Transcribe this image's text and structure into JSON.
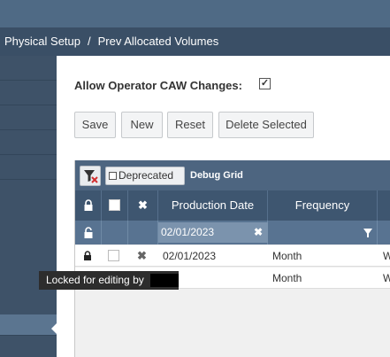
{
  "breadcrumb": {
    "items": [
      "Physical Setup",
      "Prev Allocated Volumes"
    ],
    "separator": "/"
  },
  "form": {
    "allow_operator_caw_label": "Allow Operator CAW Changes:",
    "allow_operator_caw_checked": true
  },
  "toolbar": {
    "save_label": "Save",
    "new_label": "New",
    "reset_label": "Reset",
    "delete_selected_label": "Delete Selected"
  },
  "grid": {
    "deprecated_label": "Deprecated",
    "debug_label": "Debug Grid",
    "columns": [
      "Production Date",
      "Frequency"
    ],
    "filter": {
      "production_date": "02/01/2023"
    },
    "rows": [
      {
        "locked": true,
        "checked": false,
        "production_date": "02/01/2023",
        "frequency": "Month",
        "next_col": "W"
      },
      {
        "locked": false,
        "checked": false,
        "production_date": "",
        "frequency": "Month",
        "next_col": "W"
      }
    ],
    "tooltip": "Locked for editing by"
  },
  "colors": {
    "topbar": "#4f6a85",
    "breadcrumb_bg": "#3a4f66",
    "sidebar": "#3e5268",
    "grid_header": "#3e5670",
    "grid_filter_row": "#587391",
    "tooltip_bg": "#2d2d2d"
  },
  "icons": [
    "lock-icon",
    "unlock-icon",
    "checkbox-icon",
    "close-icon",
    "filter-clear-icon",
    "funnel-icon",
    "sidebar-caret-icon"
  ]
}
